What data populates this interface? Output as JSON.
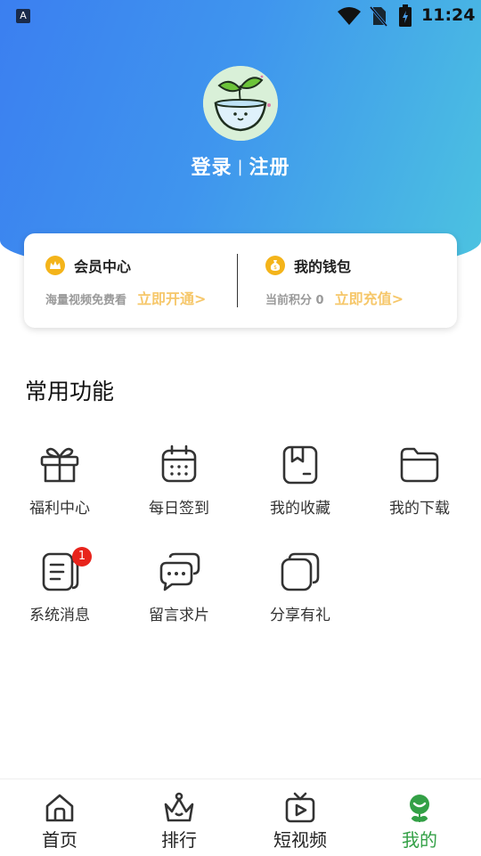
{
  "status_bar": {
    "app_badge": "A",
    "time": "11:24"
  },
  "profile": {
    "login": "登录",
    "separator": "|",
    "register": "注册"
  },
  "card": {
    "membership": {
      "title": "会员中心",
      "subtitle": "海量视频免费看",
      "link": "立即开通>"
    },
    "wallet": {
      "title": "我的钱包",
      "subtitle": "当前积分 0",
      "link": "立即充值>"
    }
  },
  "functions": {
    "title": "常用功能",
    "items": [
      {
        "label": "福利中心",
        "icon": "gift-icon"
      },
      {
        "label": "每日签到",
        "icon": "calendar-icon"
      },
      {
        "label": "我的收藏",
        "icon": "bookmark-icon"
      },
      {
        "label": "我的下载",
        "icon": "folder-icon"
      },
      {
        "label": "系统消息",
        "icon": "message-icon",
        "badge": "1"
      },
      {
        "label": "留言求片",
        "icon": "chat-bubbles-icon"
      },
      {
        "label": "分享有礼",
        "icon": "share-icon"
      }
    ]
  },
  "bottom_nav": {
    "items": [
      {
        "label": "首页",
        "icon": "home-icon"
      },
      {
        "label": "排行",
        "icon": "crown-icon"
      },
      {
        "label": "短视频",
        "icon": "tv-icon"
      },
      {
        "label": "我的",
        "icon": "user-icon",
        "active": true
      }
    ],
    "active_color": "#33a046"
  },
  "colors": {
    "gradient_start": "#3b7ff0",
    "gradient_end": "#4cc3e0",
    "link": "#f6c76a",
    "badge": "#e8241c"
  }
}
